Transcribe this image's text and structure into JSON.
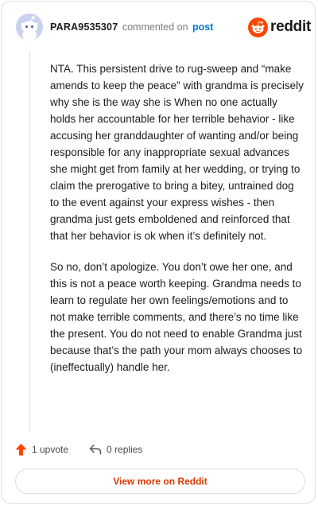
{
  "comment": {
    "username": "PARA9535307",
    "commented_on_text": "commented on",
    "post_link": "post",
    "paragraphs": [
      "NTA. This persistent drive to rug-sweep and “make amends to keep the peace” with grandma is precisely why she is the way she is When no one actually holds her accountable for her terrible behavior - like accusing her granddaughter of wanting and/or being responsible for any inappropriate sexual advances she might get from family at her wedding, or trying to claim the prerogative to bring a bitey, untrained dog to the event against your express wishes - then grandma just gets emboldened and reinforced that that her behavior is ok when it’s definitely not.",
      "So no, don’t apologize. You don’t owe her one, and this is not a peace worth keeping. Grandma needs to learn to regulate her own feelings/emotions and to not make terrible comments, and there’s no time like the present. You do not need to enable Grandma just because that’s the path your mom always chooses to (ineffectually) handle her."
    ]
  },
  "brand": {
    "wordmark": "reddit"
  },
  "actions": {
    "upvote_label": "1 upvote",
    "replies_label": "0 replies"
  },
  "footer": {
    "view_more_label": "View more on Reddit"
  },
  "colors": {
    "brand_orange": "#ff4500",
    "link_blue": "#0079d3",
    "view_more_text": "#d93a00",
    "avatar_bg": "#c9d2ef"
  },
  "icons": {
    "avatar": "snoo-avatar-icon",
    "logo": "reddit-logo-icon",
    "upvote": "upvote-arrow-icon",
    "reply": "reply-arrow-icon"
  }
}
